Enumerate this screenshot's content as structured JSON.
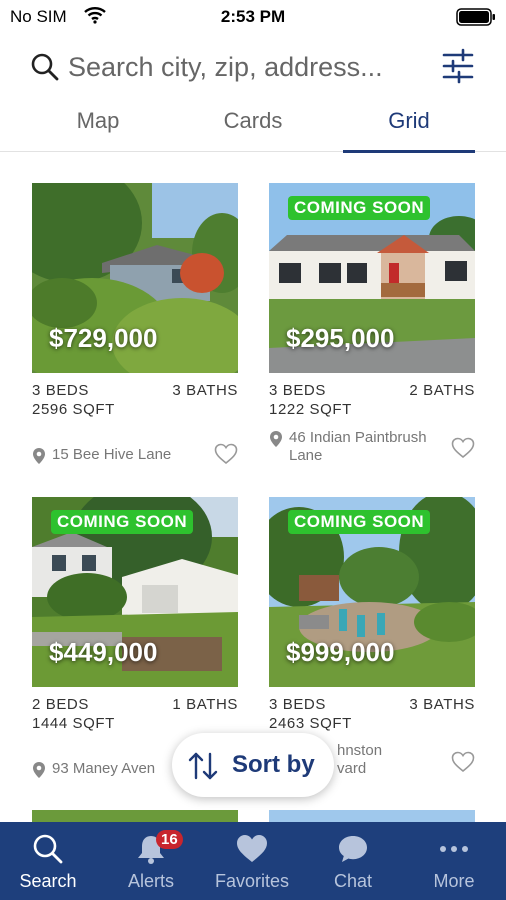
{
  "status_bar": {
    "carrier": "No SIM",
    "time": "2:53 PM"
  },
  "search": {
    "placeholder": "Search city, zip, address..."
  },
  "tabs": [
    {
      "label": "Map"
    },
    {
      "label": "Cards"
    },
    {
      "label": "Grid",
      "selected": true
    }
  ],
  "listings": [
    {
      "price": "$729,000",
      "badge": "",
      "beds": "3 BEDS",
      "baths": "3 BATHS",
      "sqft": "2596 SQFT",
      "address": "15 Bee Hive Lane"
    },
    {
      "price": "$295,000",
      "badge": "COMING SOON",
      "beds": "3 BEDS",
      "baths": "2 BATHS",
      "sqft": "1222 SQFT",
      "address": "46 Indian Paintbrush Lane"
    },
    {
      "price": "$449,000",
      "badge": "COMING SOON",
      "beds": "2 BEDS",
      "baths": "1 BATHS",
      "sqft": "1444 SQFT",
      "address": "93 Maney Aven"
    },
    {
      "price": "$999,000",
      "badge": "COMING SOON",
      "beds": "3 BEDS",
      "baths": "3 BATHS",
      "sqft": "2463 SQFT",
      "address": "hnston vard"
    }
  ],
  "sort": {
    "label": "Sort by"
  },
  "bottom_nav": {
    "items": [
      {
        "label": "Search",
        "active": true
      },
      {
        "label": "Alerts",
        "badge": "16"
      },
      {
        "label": "Favorites"
      },
      {
        "label": "Chat"
      },
      {
        "label": "More"
      }
    ]
  },
  "colors": {
    "brand_navy": "#1e3f7c",
    "accent_text": "#1e3a78",
    "badge_green": "#2ec22e",
    "alert_red": "#c8252d"
  },
  "icons": [
    "search-icon",
    "filter-sliders-icon",
    "location-pin-icon",
    "heart-outline-icon",
    "sort-arrows-icon",
    "bell-icon",
    "heart-icon",
    "chat-bubble-icon",
    "more-dots-icon",
    "wifi-icon",
    "battery-icon"
  ]
}
